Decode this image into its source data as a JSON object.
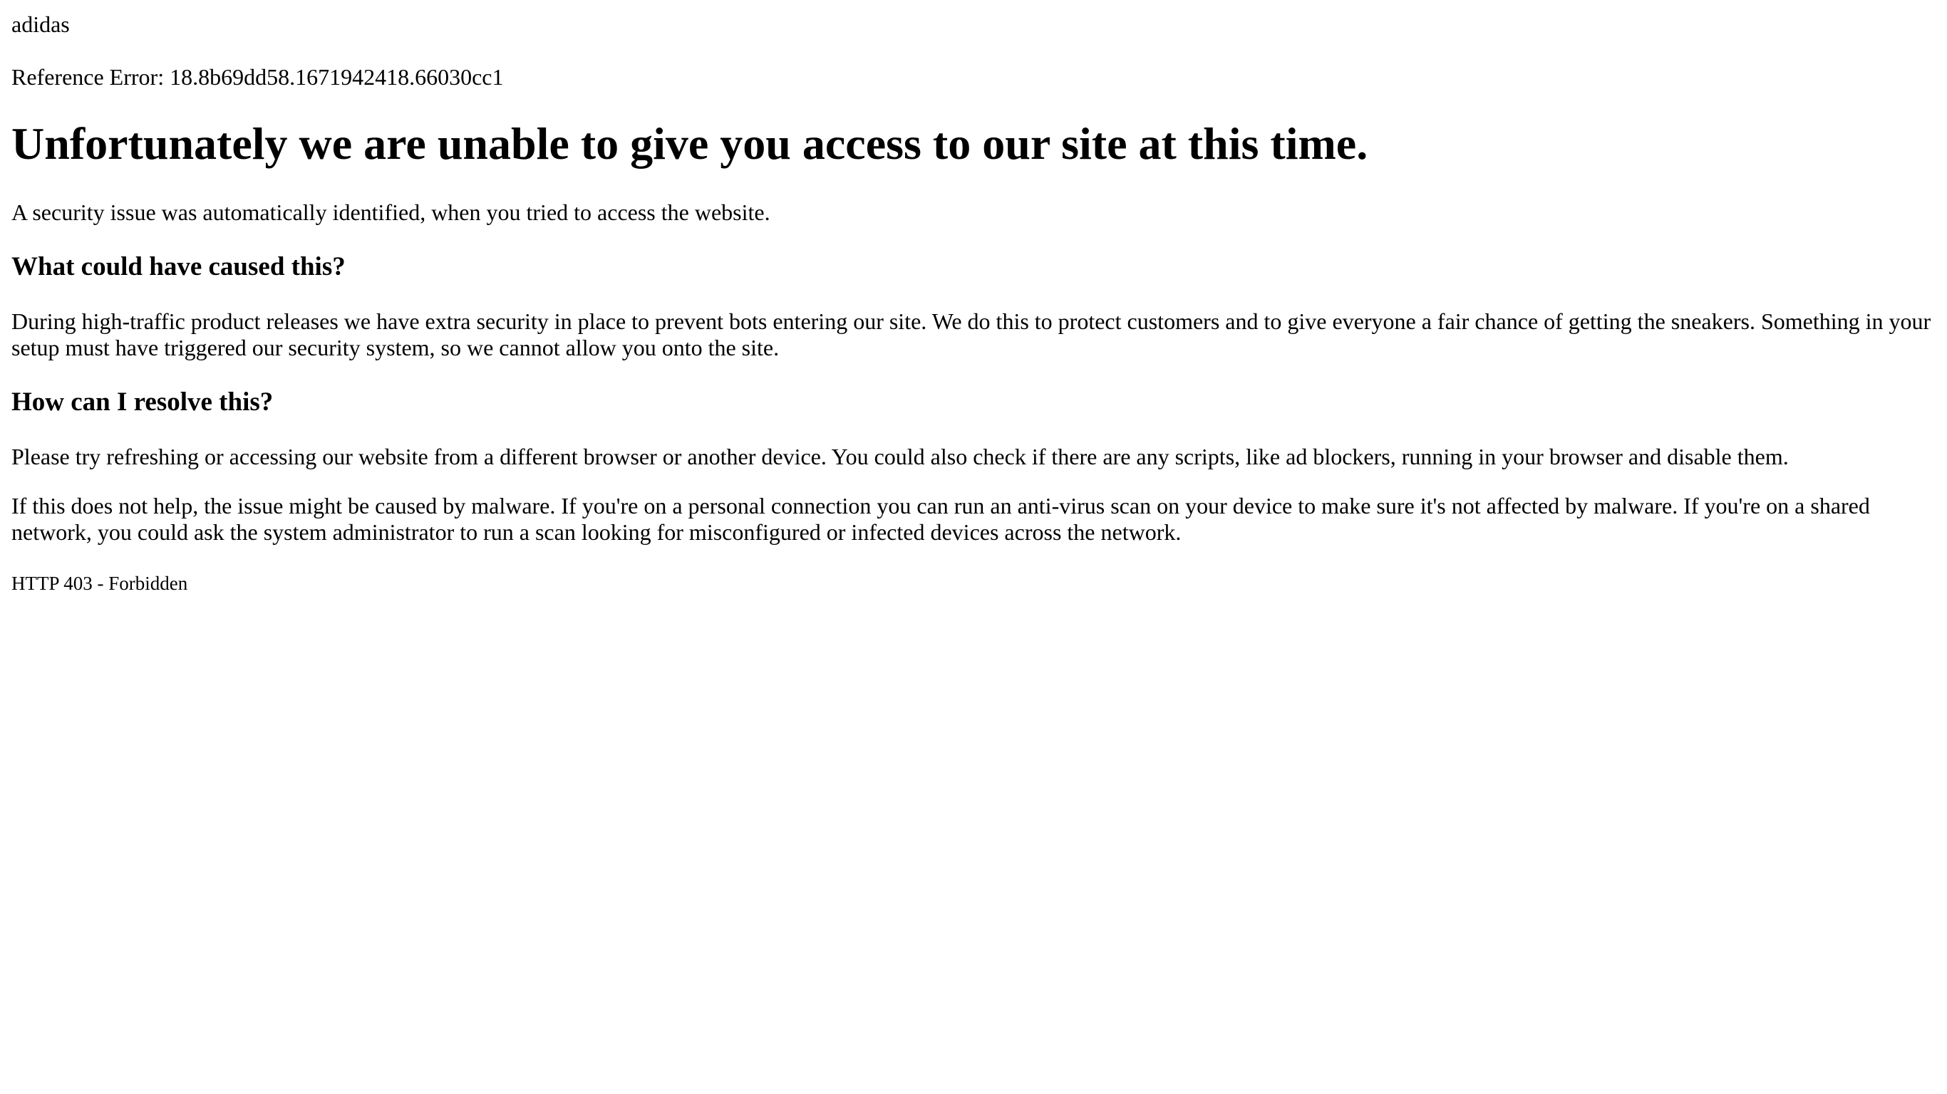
{
  "brand": "adidas",
  "reference": {
    "label": "Reference Error:",
    "code": "18.8b69dd58.1671942418.66030cc1"
  },
  "headline": "Unfortunately we are unable to give you access to our site at this time.",
  "intro": "A security issue was automatically identified, when you tried to access the website.",
  "sections": {
    "cause": {
      "heading": "What could have caused this?",
      "body": "During high-traffic product releases we have extra security in place to prevent bots entering our site. We do this to protect customers and to give everyone a fair chance of getting the sneakers. Something in your setup must have triggered our security system, so we cannot allow you onto the site."
    },
    "resolve": {
      "heading": "How can I resolve this?",
      "body": "Please try refreshing or accessing our website from a different browser or another device. You could also check if there are any scripts, like ad blockers, running in your browser and disable them.",
      "malware": "If this does not help, the issue might be caused by malware. If you're on a personal connection you can run an anti-virus scan on your device to make sure it's not affected by malware. If you're on a shared network, you could ask the system administrator to run a scan looking for misconfigured or infected devices across the network."
    }
  },
  "status": "HTTP 403 - Forbidden"
}
